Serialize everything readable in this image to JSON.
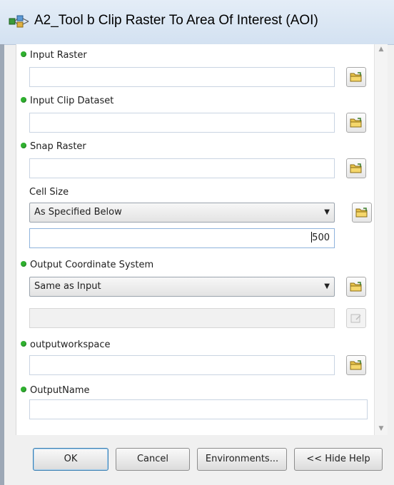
{
  "window": {
    "title": "A2_Tool b Clip Raster To Area Of Interest (AOI)",
    "icon": "model-tool-icon"
  },
  "params": {
    "input_raster": {
      "label": "Input Raster",
      "value": ""
    },
    "input_clip_dataset": {
      "label": "Input Clip Dataset",
      "value": ""
    },
    "snap_raster": {
      "label": "Snap Raster",
      "value": ""
    },
    "cell_size": {
      "label": "Cell Size",
      "selected": "As Specified Below",
      "value": "500"
    },
    "output_coordinate_system": {
      "label": "Output Coordinate System",
      "selected": "Same as Input",
      "value": ""
    },
    "output_workspace": {
      "label": "outputworkspace",
      "value": ""
    },
    "output_name": {
      "label": "OutputName",
      "value": ""
    }
  },
  "buttons": {
    "ok": "OK",
    "cancel": "Cancel",
    "environments": "Environments...",
    "hide_help": "<< Hide Help"
  },
  "colors": {
    "required_dot": "#2fb12f",
    "title_bar": "#d3e1f1",
    "folder_icon": "#e8c34a"
  }
}
